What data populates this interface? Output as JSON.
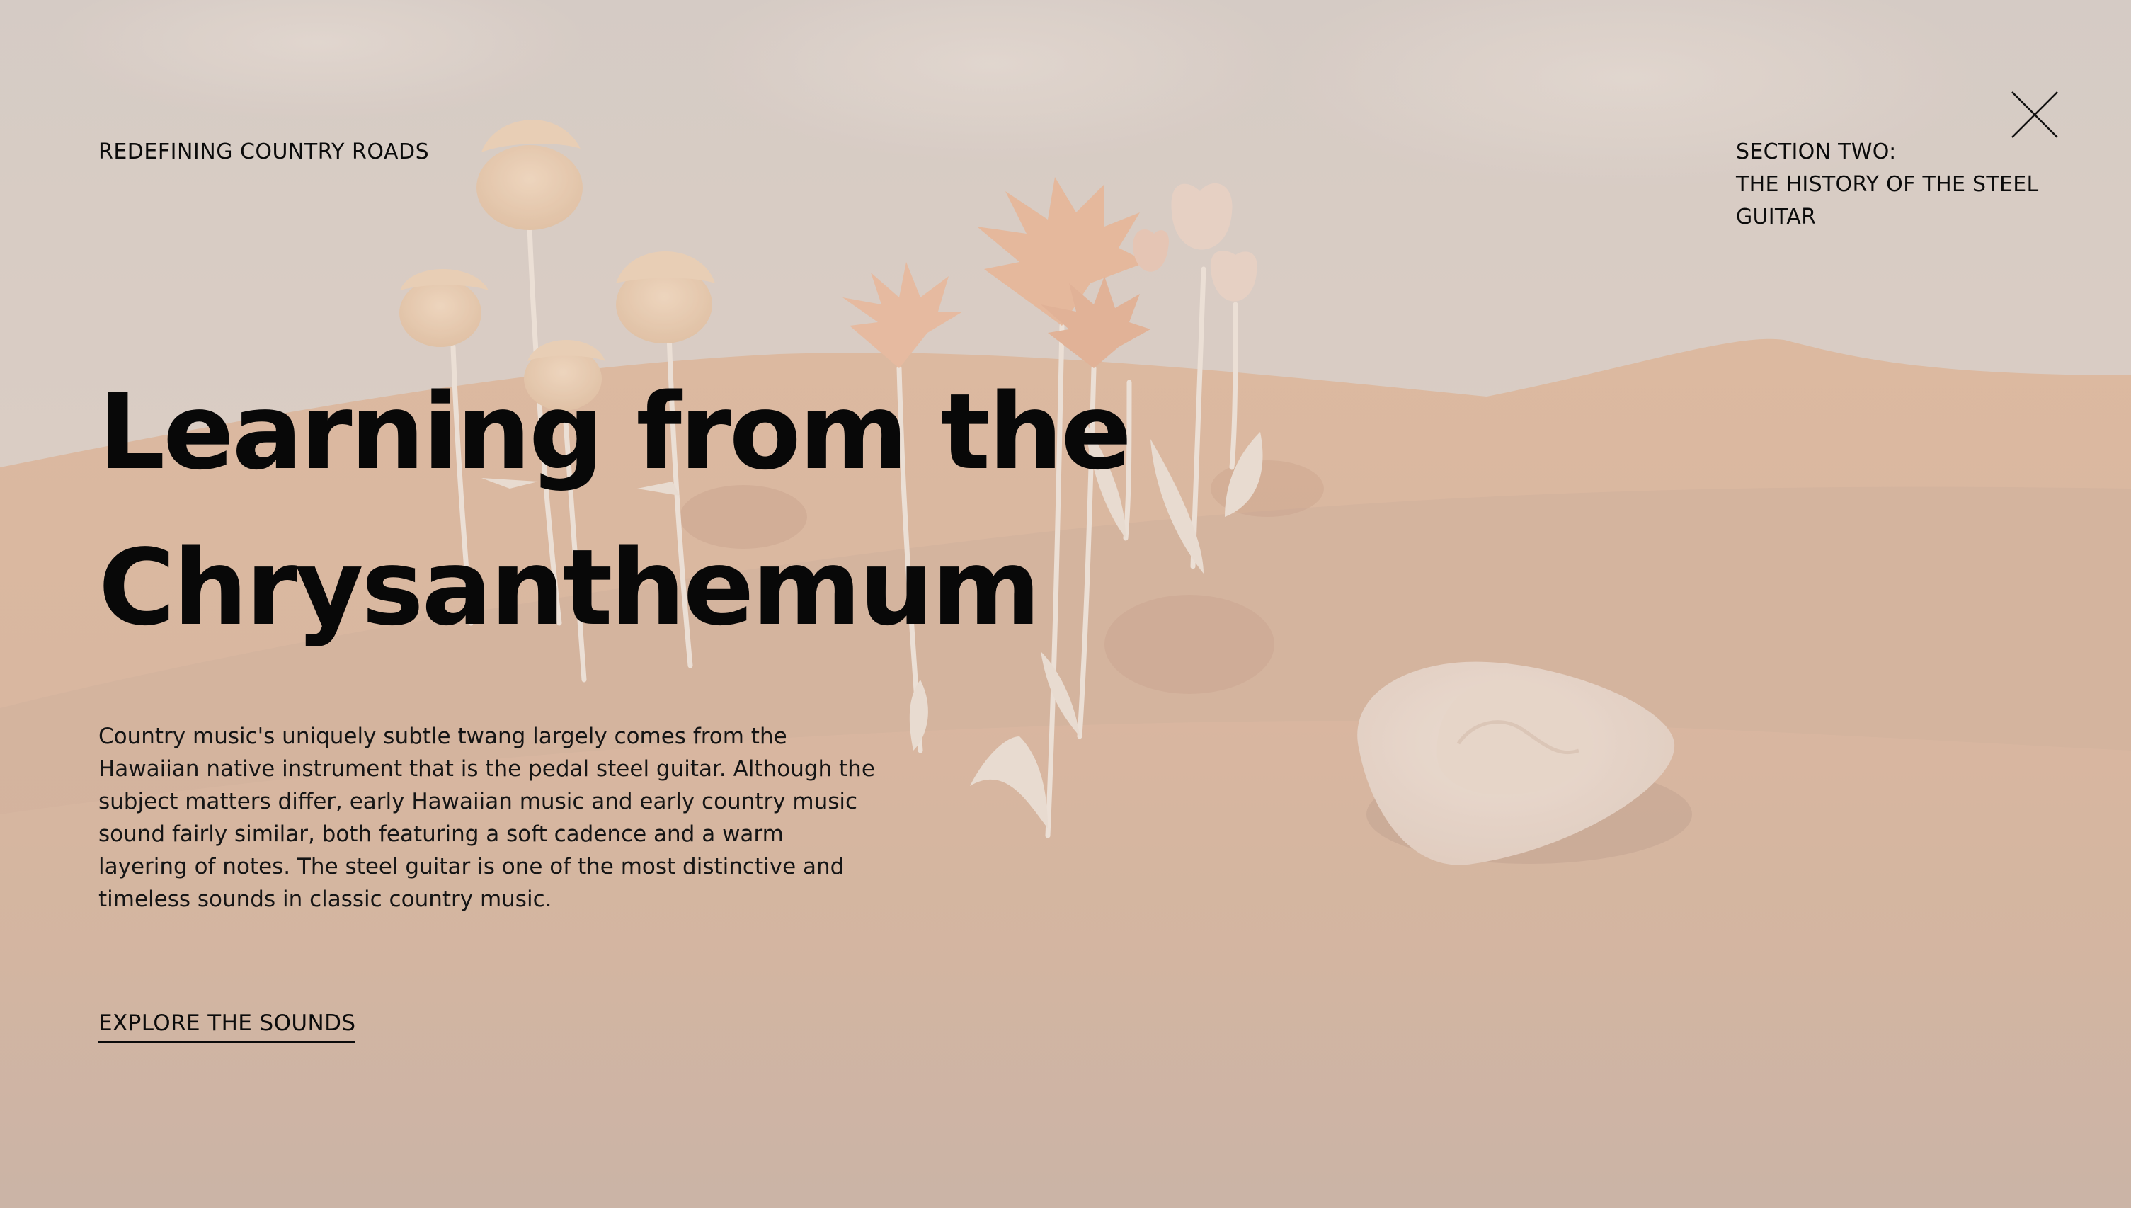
{
  "header": {
    "site_title": "REDEFINING COUNTRY ROADS",
    "section_label_line1": "SECTION TWO:",
    "section_label_line2": "THE HISTORY OF THE STEEL",
    "section_label_line3": "GUITAR",
    "close_icon": "close-x-icon"
  },
  "hero": {
    "title_line1": "Learning from the",
    "title_line2": "Chrysanthemum",
    "body": "Country music's uniquely subtle twang largely comes from the Hawaiian native instrument that is the pedal steel guitar. Although the subject matters differ, early Hawaiian music and early country music sound fairly similar, both featuring a soft cadence and a warm layering of notes. The steel guitar is one of the most distinctive and timeless sounds in classic country music.",
    "cta_label": "EXPLORE THE SOUNDS"
  },
  "colors": {
    "sky_top": "#d8ccc6",
    "sand": "#d2b09a",
    "text": "#0b0b0b"
  }
}
